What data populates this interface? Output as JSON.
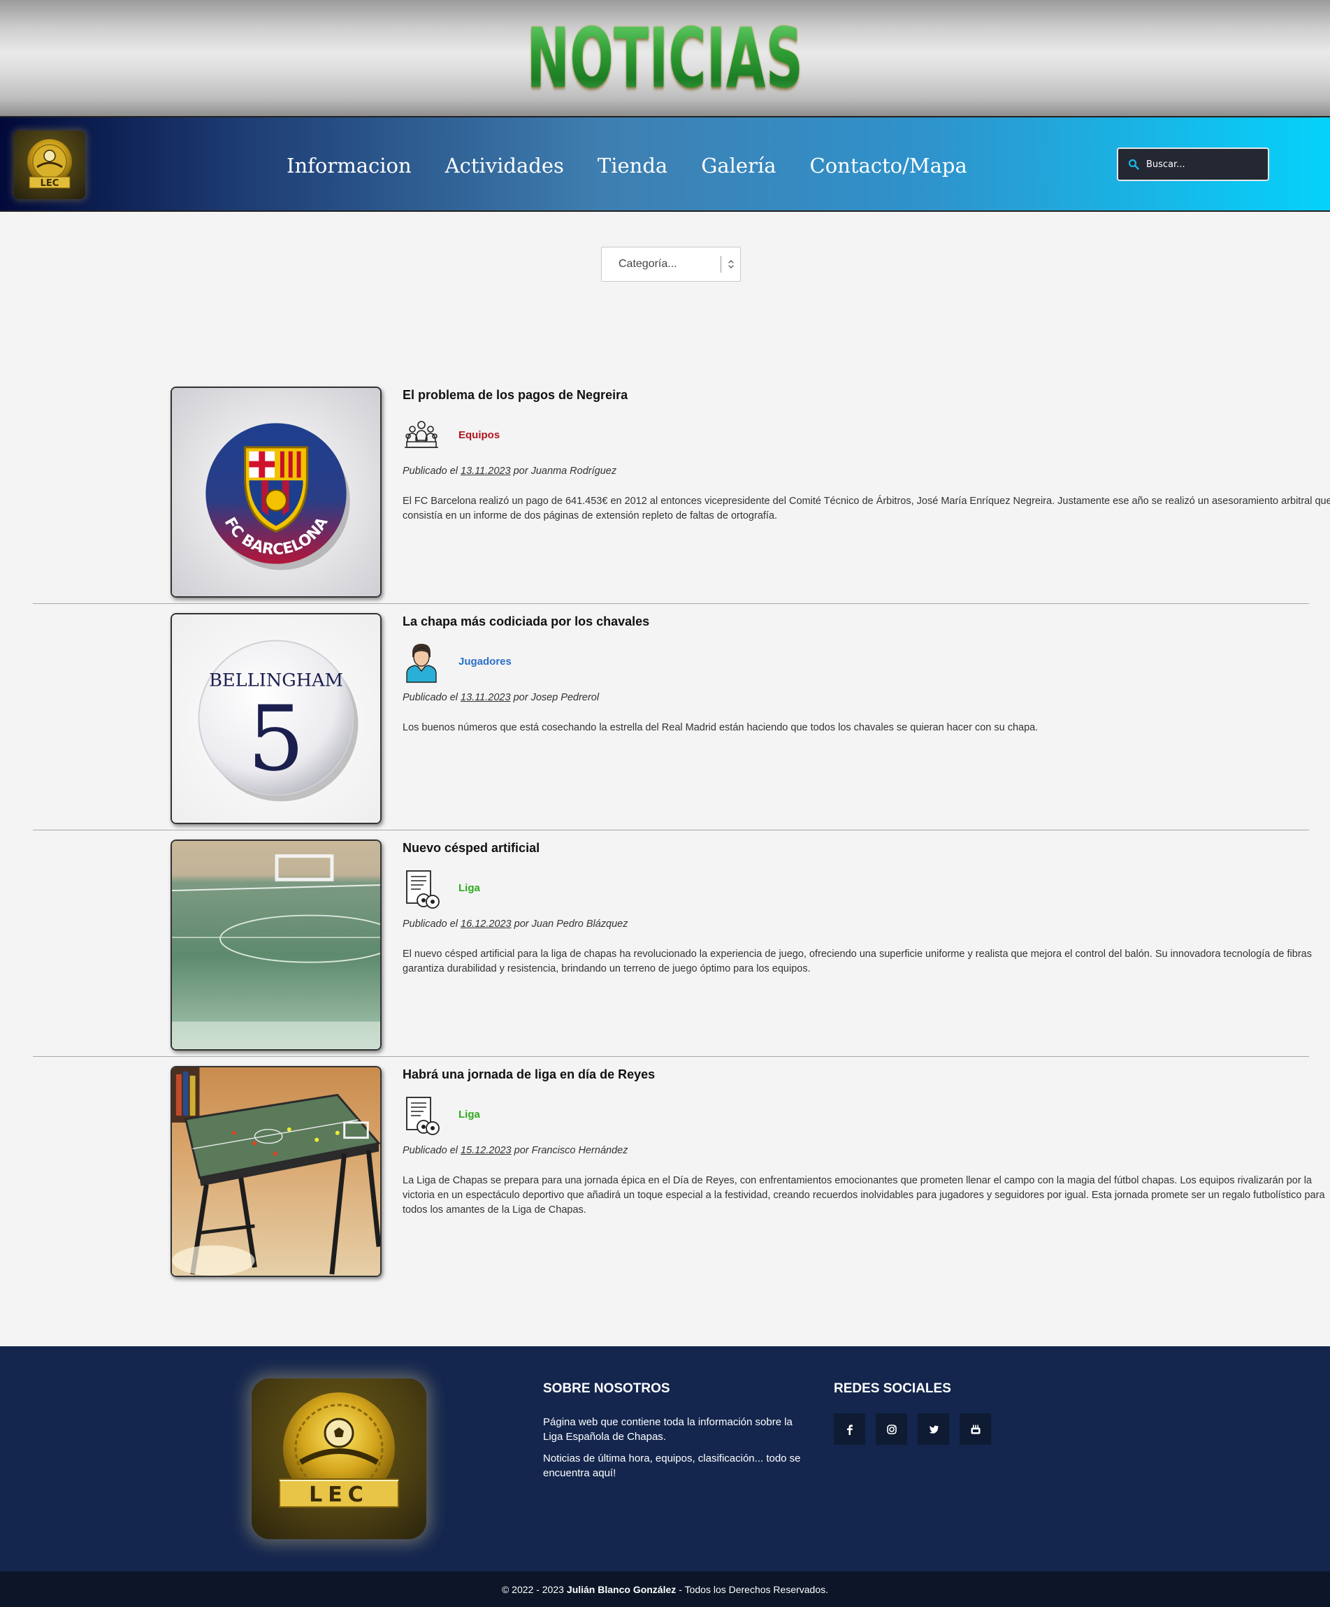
{
  "banner": {
    "title": "NOTICIAS"
  },
  "nav": {
    "logo_text": "LEC",
    "links": [
      {
        "label": "Informacion"
      },
      {
        "label": "Actividades"
      },
      {
        "label": "Tienda"
      },
      {
        "label": "Galería"
      },
      {
        "label": "Contacto/Mapa"
      }
    ],
    "search": {
      "placeholder": "Buscar..."
    }
  },
  "filter": {
    "category_select": "Categoría..."
  },
  "articles": [
    {
      "title": "El problema de los pagos de Negreira",
      "category": "Equipos",
      "category_color": "#b0151f",
      "category_icon": "team-icon",
      "published_prefix": "Publicado el",
      "date": "13.11.2023",
      "by_prefix": "por",
      "author": "Juanma Rodríguez",
      "excerpt": "El FC Barcelona realizó un pago de 641.453€ en 2012 al entonces vicepresidente del Comité Técnico de Árbitros, José María Enríquez Negreira. Justamente ese año se realizó un asesoramiento arbitral que consistía en un informe de dos páginas de extensión repleto de faltas de ortografía.",
      "image": {
        "badge_text": "FC BARCELONA"
      }
    },
    {
      "title": "La chapa más codiciada por los chavales",
      "category": "Jugadores",
      "category_color": "#2a6fc9",
      "category_icon": "player-icon",
      "published_prefix": "Publicado el",
      "date": "13.11.2023",
      "by_prefix": "por",
      "author": "Josep Pedrerol",
      "excerpt": "Los buenos números que está cosechando la estrella del Real Madrid están haciendo que todos los chavales se quieran hacer con su chapa.",
      "image": {
        "name_text": "BELLINGHAM",
        "number_text": "5"
      }
    },
    {
      "title": "Nuevo césped artificial",
      "category": "Liga",
      "category_color": "#2fa91f",
      "category_icon": "league-icon",
      "published_prefix": "Publicado el",
      "date": "16.12.2023",
      "by_prefix": "por",
      "author": "Juan Pedro Blázquez",
      "excerpt": "El nuevo césped artificial para la liga de chapas ha revolucionado la experiencia de juego, ofreciendo una superficie uniforme y realista que mejora el control del balón. Su innovadora tecnología de fibras garantiza durabilidad y resistencia, brindando un terreno de juego óptimo para los equipos.",
      "image": {}
    },
    {
      "title": "Habrá una jornada de liga en día de Reyes",
      "category": "Liga",
      "category_color": "#2fa91f",
      "category_icon": "league-icon",
      "published_prefix": "Publicado el",
      "date": "15.12.2023",
      "by_prefix": "por",
      "author": "Francisco Hernández",
      "excerpt": "La Liga de Chapas se prepara para una jornada épica en el Día de Reyes, con enfrentamientos emocionantes que prometen llenar el campo con la magia del fútbol chapas. Los equipos rivalizarán por la victoria en un espectáculo deportivo que añadirá un toque especial a la festividad, creando recuerdos inolvidables para jugadores y seguidores por igual. Esta jornada promete ser un regalo futbolístico para todos los amantes de la Liga de Chapas.",
      "image": {}
    }
  ],
  "footer": {
    "logo_text": "LEC",
    "about_heading": "SOBRE NOSOTROS",
    "about_p1": "Página web que contiene toda la información sobre la Liga Española de Chapas.",
    "about_p2": "Noticias de última hora, equipos, clasificación... todo se encuentra aquí!",
    "social_heading": "REDES SOCIALES",
    "social": [
      "facebook-icon",
      "instagram-icon",
      "twitter-icon",
      "youtube-icon"
    ],
    "copyright_prefix": "© 2022 - 2023",
    "copyright_name": "Julián Blanco González",
    "copyright_suffix": "- Todos los Derechos Reservados."
  }
}
